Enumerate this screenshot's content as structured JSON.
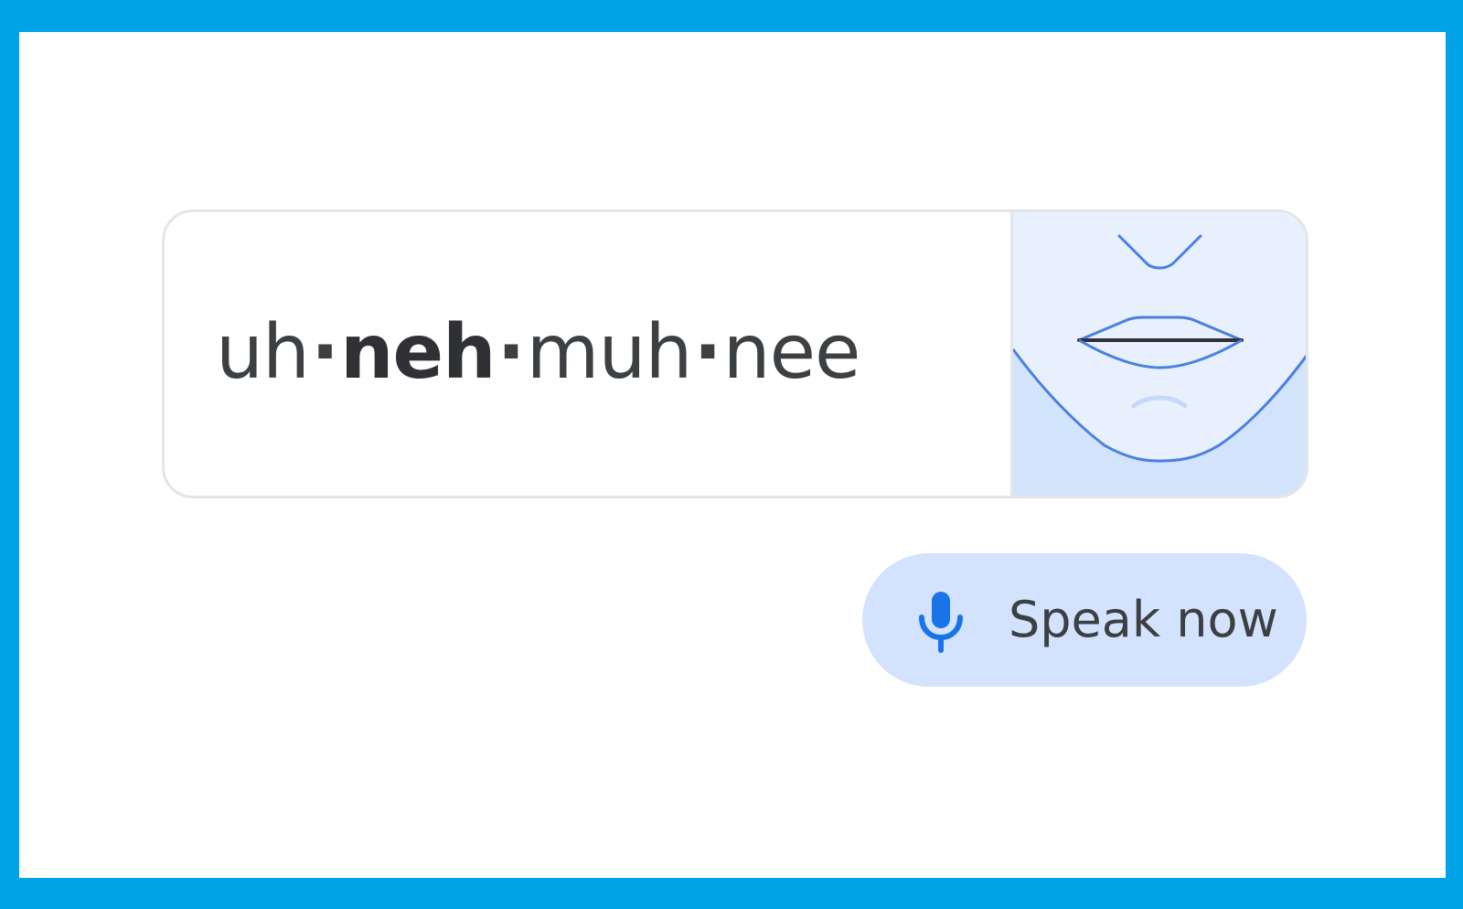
{
  "pronunciation": {
    "syllables": [
      {
        "text": "uh",
        "stressed": false
      },
      {
        "text": "neh",
        "stressed": true
      },
      {
        "text": "muh",
        "stressed": false
      },
      {
        "text": "nee",
        "stressed": false
      }
    ],
    "separator": "·"
  },
  "mouth_illustration": {
    "icon": "mouth-shape-illustration",
    "line_color": "#4285f4",
    "fill_top": "#e8f0fe",
    "fill_bottom": "#d2e3fc"
  },
  "speak_button": {
    "label": "Speak now",
    "icon": "microphone-icon"
  },
  "colors": {
    "border_frame": "#00a3e8",
    "accent": "#1a73e8",
    "button_bg": "#d3e3fd",
    "text": "#3c4043"
  }
}
